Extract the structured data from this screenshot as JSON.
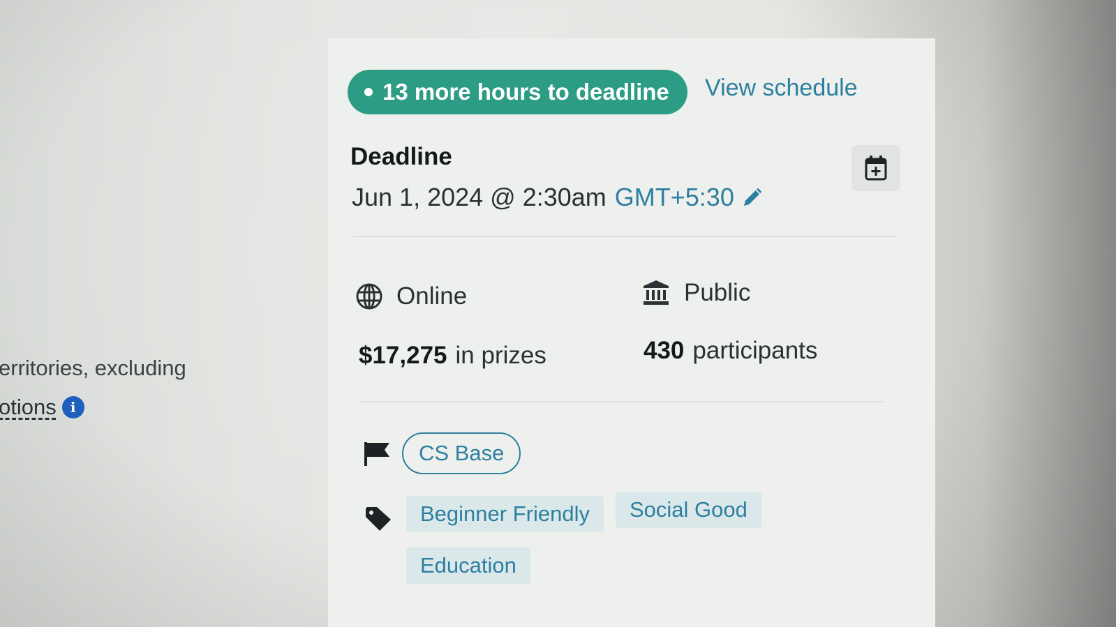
{
  "left_text": {
    "line1": "erritories, excluding",
    "line2": "otions"
  },
  "deadline_badge": {
    "text": "13 more hours to deadline",
    "color": "#2c9c84"
  },
  "view_schedule_link": "View schedule",
  "deadline": {
    "label": "Deadline",
    "date": "Jun 1, 2024 @ 2:30am",
    "timezone": "GMT+5:30"
  },
  "details": {
    "location": "Online",
    "visibility": "Public",
    "prizes_amount": "$17,275",
    "prizes_suffix": "in prizes",
    "participants_count": "430",
    "participants_suffix": "participants"
  },
  "theme": {
    "chip": "CS Base"
  },
  "tags": [
    "Beginner Friendly",
    "Social Good",
    "Education"
  ],
  "colors": {
    "accent": "#2d7fa0",
    "badge": "#2c9c84",
    "tag_bg": "#dbe8ea"
  },
  "icons": {
    "calendar": "calendar-add-icon",
    "location": "globe-icon",
    "visibility": "bank-icon",
    "theme": "flag-icon",
    "tags": "tag-icon",
    "edit": "pencil-icon",
    "info": "info-icon"
  }
}
